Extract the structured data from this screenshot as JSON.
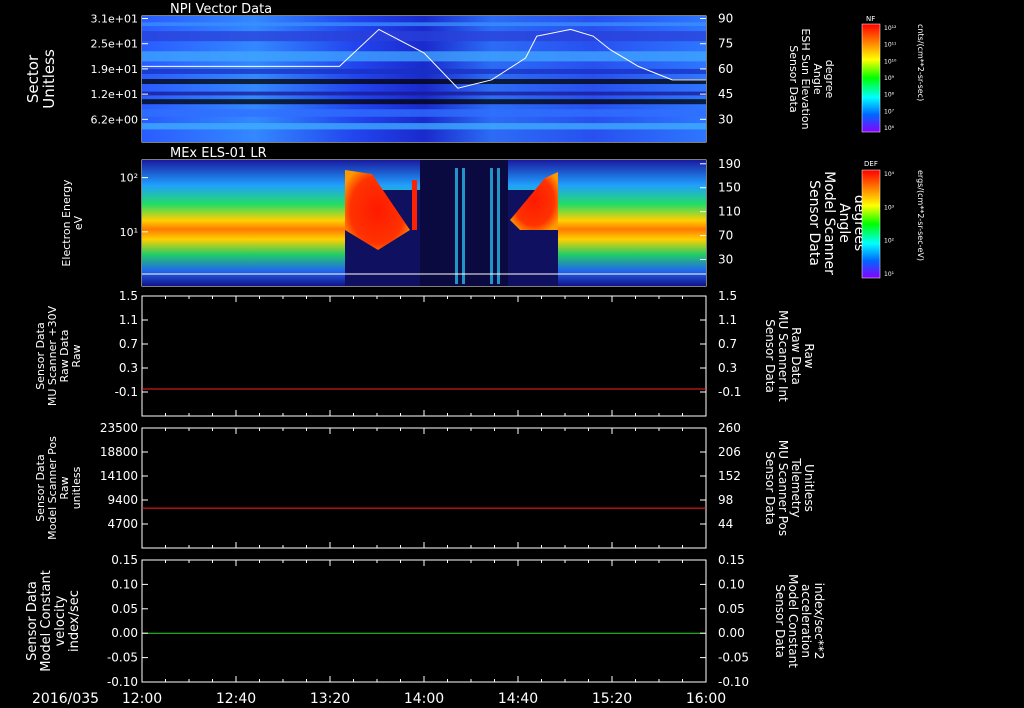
{
  "date_label": "2016/035",
  "time_ticks": [
    "12:00",
    "12:40",
    "13:20",
    "14:00",
    "14:40",
    "15:20",
    "16:00"
  ],
  "colors": {
    "white": "#ffffff",
    "red": "#ff2020",
    "green": "#22dd22"
  },
  "colorbars": [
    {
      "tag": "NF",
      "unit": "cnts/(cm**2-sr-sec)",
      "ticks": [
        "10¹²",
        "10¹¹",
        "10¹⁰",
        "10⁹",
        "10⁸",
        "10⁷",
        "10⁶"
      ]
    },
    {
      "tag": "DEF",
      "unit": "ergs/(cm**2-sr-sec-eV)",
      "ticks": [
        "10⁴",
        "10³",
        "10²",
        "10¹"
      ]
    }
  ],
  "chart_data": [
    {
      "type": "heatmap",
      "title": "NPI Vector Data",
      "ylabel": [
        "Sector",
        "Unitless"
      ],
      "y_ticks": [
        "3.1e+01",
        "2.5e+01",
        "1.9e+01",
        "1.2e+01",
        "6.2e+00"
      ],
      "right_axis": {
        "label": [
          "Sensor Data",
          "ESH Sun Elevation",
          "Angle",
          "degree"
        ],
        "ticks": [
          "90",
          "75",
          "60",
          "45",
          "30"
        ],
        "ylim": [
          15,
          90
        ]
      },
      "line_series": {
        "x": [
          0,
          0.35,
          0.42,
          0.5,
          0.56,
          0.62,
          0.68,
          0.7,
          0.76,
          0.8,
          0.83,
          0.88,
          0.94,
          1.0
        ],
        "y": [
          60,
          60,
          82,
          68,
          47,
          52,
          65,
          78,
          82,
          78,
          70,
          60,
          52,
          52
        ]
      }
    },
    {
      "type": "heatmap",
      "title": "MEx ELS-01 LR",
      "ylabel": [
        "Electron Energy",
        "eV"
      ],
      "y_ticks": [
        "10²",
        "10¹"
      ],
      "right_axis": {
        "label": [
          "Sensor Data",
          "Model Scanner",
          "Angle",
          "degrees"
        ],
        "ticks": [
          "190",
          "150",
          "110",
          "70",
          "30"
        ],
        "ylim": [
          0,
          190
        ]
      }
    },
    {
      "type": "line",
      "left_label": [
        "Sensor Data",
        "MU Scanner +30V",
        "Raw Data",
        "Raw"
      ],
      "left_ticks": [
        "1.5",
        "1.1",
        "0.7",
        "0.3",
        "-0.1"
      ],
      "ylim": [
        -0.5,
        1.5
      ],
      "right_label": [
        "Sensor Data",
        "MU Scanner Int",
        "Raw Data",
        "Raw"
      ],
      "right_ticks": [
        "1.5",
        "1.1",
        "0.7",
        "0.3",
        "-0.1"
      ],
      "series": [
        {
          "x": [
            12.0,
            16.0
          ],
          "y": [
            -0.05,
            -0.05
          ]
        }
      ]
    },
    {
      "type": "line",
      "left_label": [
        "Sensor Data",
        "Model Scanner Pos",
        "Raw",
        "unitless"
      ],
      "left_ticks": [
        "23500",
        "18800",
        "14100",
        "9400",
        "4700"
      ],
      "ylim": [
        0,
        23500
      ],
      "right_label": [
        "Sensor Data",
        "MU Scanner Pos",
        "Telemetry",
        "Unitless"
      ],
      "right_ticks": [
        "260",
        "206",
        "152",
        "98",
        "44"
      ],
      "series": [
        {
          "x": [
            12.0,
            16.0
          ],
          "y": [
            7800,
            7800
          ]
        }
      ]
    },
    {
      "type": "line",
      "left_label": [
        "Sensor Data",
        "Model Constant",
        "velocity",
        "index/sec"
      ],
      "left_ticks": [
        "0.15",
        "0.10",
        "0.05",
        "0.00",
        "-0.05",
        "-0.10"
      ],
      "ylim": [
        -0.1,
        0.15
      ],
      "right_label": [
        "Sensor Data",
        "Model Constant",
        "acceleration",
        "index/sec**2"
      ],
      "right_ticks": [
        "0.15",
        "0.10",
        "0.05",
        "0.00",
        "-0.05",
        "-0.10"
      ],
      "series": [
        {
          "x": [
            12.0,
            16.0
          ],
          "y": [
            0.0,
            0.0
          ]
        }
      ]
    }
  ]
}
